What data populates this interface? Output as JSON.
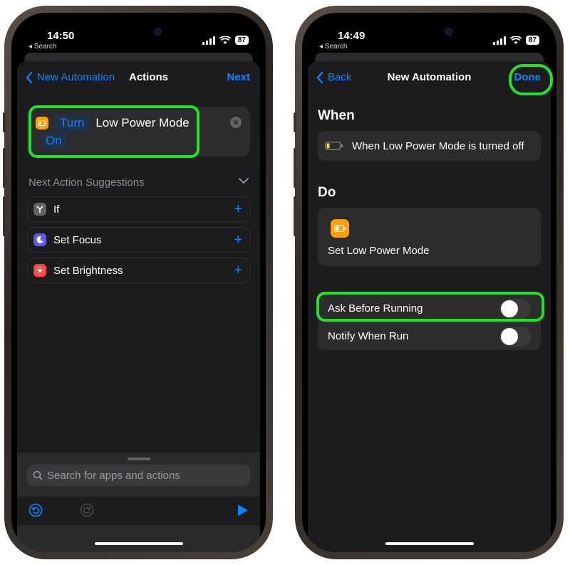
{
  "left_phone": {
    "status": {
      "time": "14:50",
      "back_label": "◂ Search",
      "battery": "87"
    },
    "nav": {
      "back_label": "New Automation",
      "title": "Actions",
      "next_label": "Next"
    },
    "action": {
      "verb": "Turn",
      "object": "Low Power Mode",
      "value": "On",
      "icon": "battery-icon"
    },
    "suggestions": {
      "title": "Next Action Suggestions",
      "items": [
        {
          "label": "If",
          "icon": "if-icon",
          "color": "#636366"
        },
        {
          "label": "Set Focus",
          "icon": "moon-icon",
          "color": "#5e5ce6"
        },
        {
          "label": "Set Brightness",
          "icon": "sun-icon",
          "color": "#ff453a"
        }
      ]
    },
    "search": {
      "placeholder": "Search for apps and actions"
    }
  },
  "right_phone": {
    "status": {
      "time": "14:49",
      "back_label": "◂ Search",
      "battery": "87"
    },
    "nav": {
      "back_label": "Back",
      "title": "New Automation",
      "done_label": "Done"
    },
    "when": {
      "heading": "When",
      "trigger": "When Low Power Mode is turned off"
    },
    "do": {
      "heading": "Do",
      "action": "Set Low Power Mode"
    },
    "options": [
      {
        "label": "Ask Before Running",
        "on": false
      },
      {
        "label": "Notify When Run",
        "on": false
      }
    ]
  },
  "colors": {
    "accent": "#0a84ff",
    "highlight": "#21e12a",
    "battery_icon": "#ff9f0a"
  }
}
